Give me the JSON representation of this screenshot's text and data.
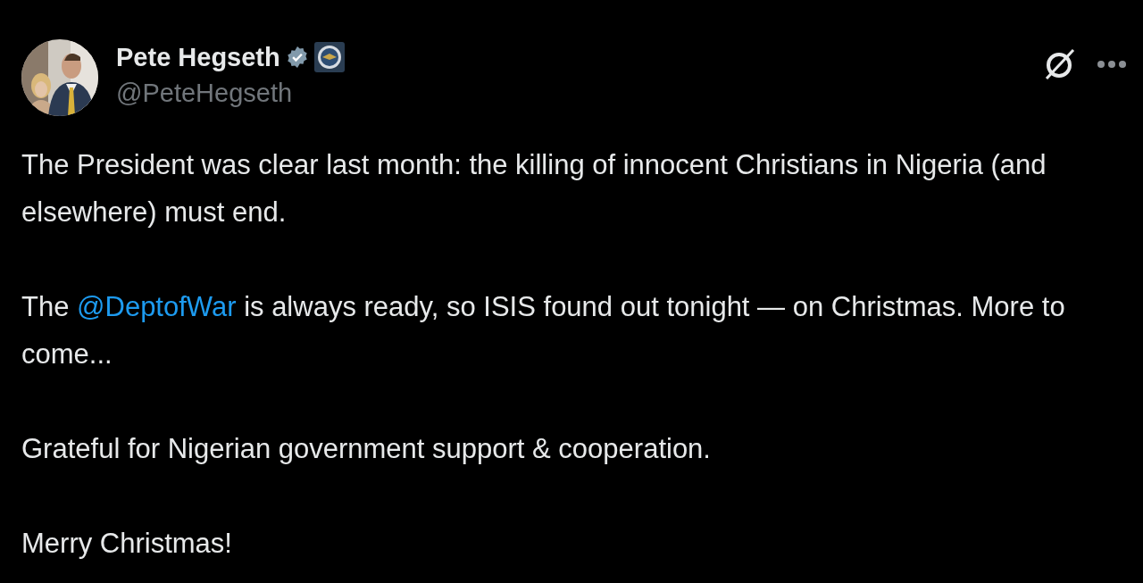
{
  "author": {
    "name": "Pete Hegseth",
    "verified": true,
    "handle": "@PeteHegseth"
  },
  "paragraphs": [
    {
      "parts": [
        {
          "kind": "text",
          "text": "The President was clear last month: the killing of innocent Christians in Nigeria (and elsewhere) must end."
        }
      ]
    },
    {
      "parts": [
        {
          "kind": "text",
          "text": "The "
        },
        {
          "kind": "mention",
          "text": "@DeptofWar"
        },
        {
          "kind": "text",
          "text": " is always ready, so ISIS found out tonight — on Christmas. More to come..."
        }
      ]
    },
    {
      "parts": [
        {
          "kind": "text",
          "text": "Grateful for Nigerian government support & cooperation."
        }
      ]
    },
    {
      "parts": [
        {
          "kind": "text",
          "text": "Merry Christmas!"
        }
      ]
    }
  ]
}
